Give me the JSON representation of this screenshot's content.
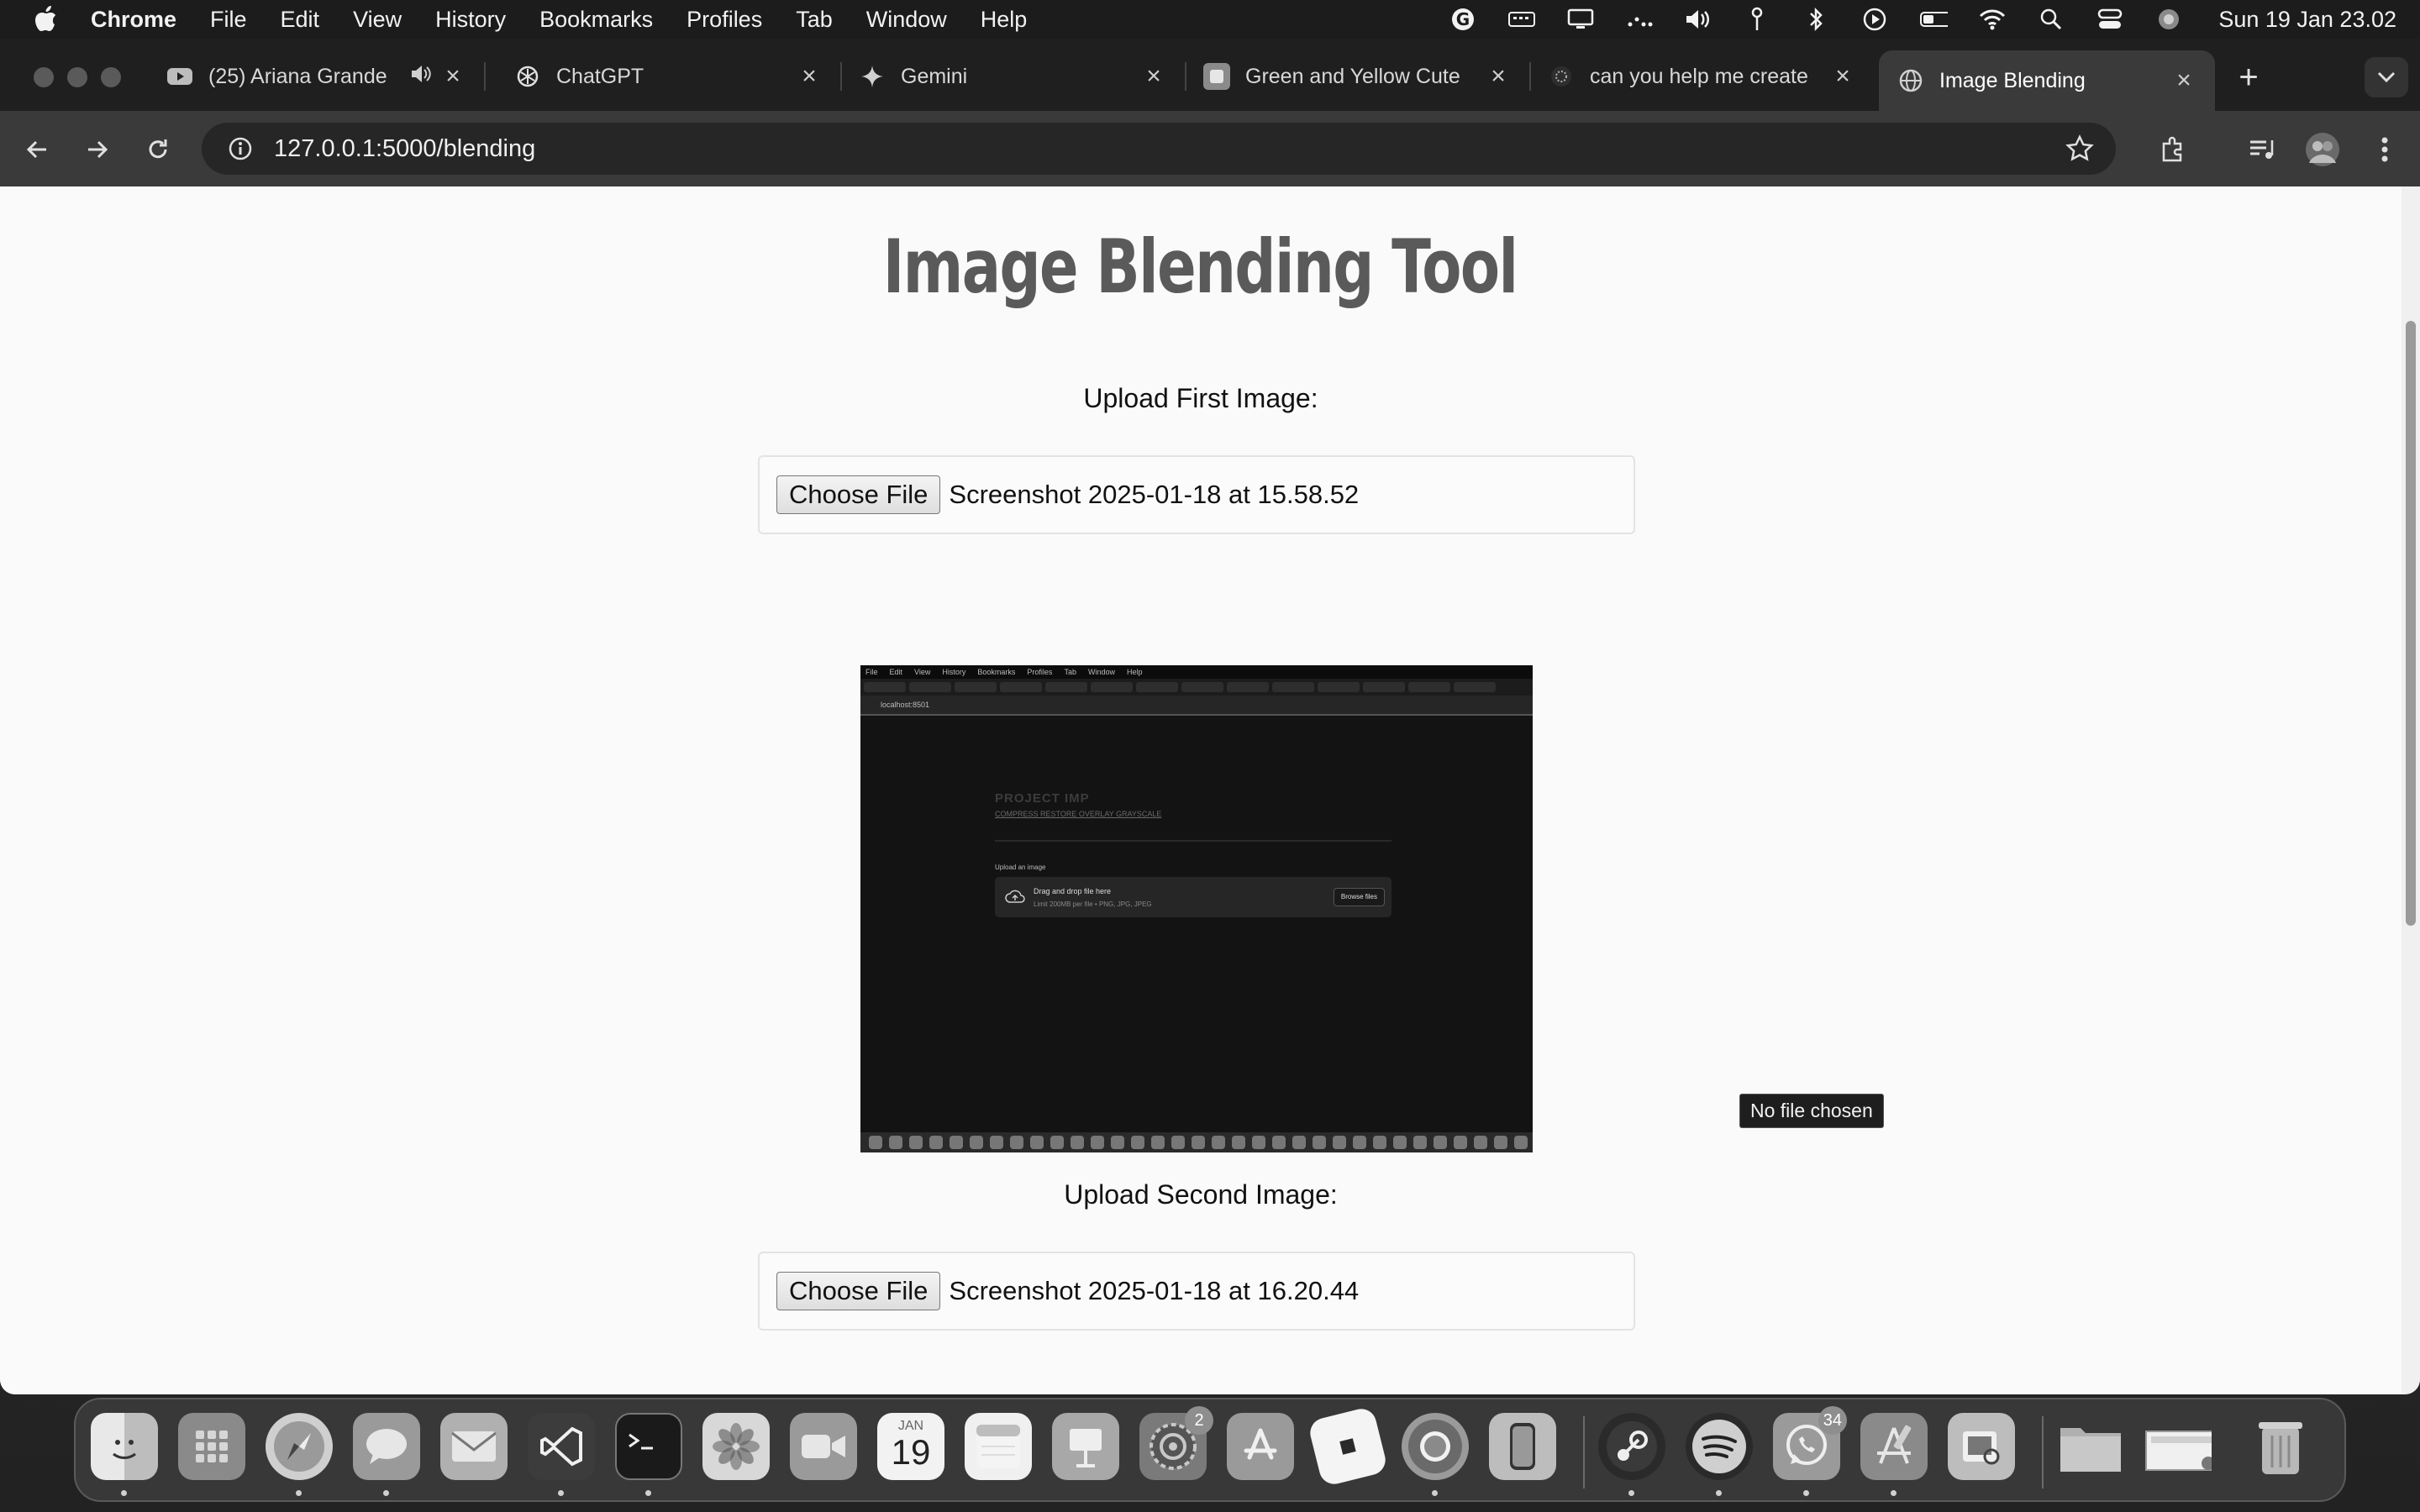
{
  "menubar": {
    "app": "Chrome",
    "items": [
      "File",
      "Edit",
      "View",
      "History",
      "Bookmarks",
      "Profiles",
      "Tab",
      "Window",
      "Help"
    ],
    "clock": "Sun 19 Jan  23.02"
  },
  "tabs": [
    {
      "title": "(25) Ariana Grande",
      "icon": "youtube-icon"
    },
    {
      "title": "ChatGPT",
      "icon": "chatgpt-icon"
    },
    {
      "title": "Gemini",
      "icon": "gemini-icon"
    },
    {
      "title": "Green and Yellow Cute",
      "icon": "canva-icon"
    },
    {
      "title": "can you help me create",
      "icon": "chat-icon"
    },
    {
      "title": "Image Blending",
      "icon": "globe-icon",
      "active": true
    }
  ],
  "omnibox": {
    "url": "127.0.0.1:5000/blending"
  },
  "page": {
    "heading": "Image Blending Tool",
    "first_label": "Upload First Image:",
    "first_file_button": "Choose File",
    "first_file_name": "Screenshot 2025-01-18 at 15.58.52",
    "second_label": "Upload Second Image:",
    "second_file_button": "Choose File",
    "second_file_name": "Screenshot 2025-01-18 at 16.20.44",
    "tooltip": "No file chosen"
  },
  "preview": {
    "menu_items": [
      "File",
      "Edit",
      "View",
      "History",
      "Bookmarks",
      "Profiles",
      "Tab",
      "Window",
      "Help"
    ],
    "address": "localhost:8501",
    "title": "PROJECT IMP",
    "links": "COMPRESS RESTORE OVERLAY GRAYSCALE",
    "upload_label": "Upload an image",
    "drop_title": "Drag and drop file here",
    "drop_subtitle": "Limit 200MB per file • PNG, JPG, JPEG",
    "browse_button": "Browse files"
  },
  "dock": {
    "calendar_month": "JAN",
    "calendar_day": "19",
    "badges": {
      "settings": "2",
      "whatsapp": "34"
    }
  }
}
